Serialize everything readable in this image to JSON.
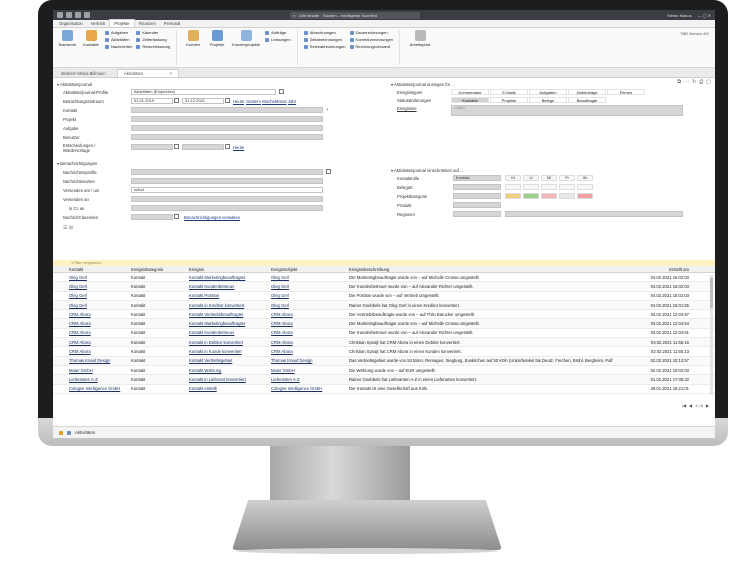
{
  "app": {
    "search_placeholder": "Alle Inhalte",
    "search_hint": "Suchen – Intelligente Suchfeld",
    "user": "Stefan Manos",
    "company": "TBB Service AG"
  },
  "ribbon_tabs": [
    "Organisation",
    "Vertrieb",
    "Projekte",
    "Finanzen",
    "Personal"
  ],
  "ribbon": {
    "teamwork": "Teamwork",
    "kontakte": "Kontakte",
    "aufgaben": "Aufgaben",
    "aktivitaeten": "Aktivitäten",
    "nachrichten": "Nachrichten",
    "kalender": "Kalender",
    "zeiterfassung": "Zeiterfassung",
    "reiseerfassung": "Reiseerfassung",
    "kunden": "Kunden",
    "projekte": "Projekte",
    "kundenprojekte": "Kundenprojekte",
    "auftraege": "Aufträge",
    "leistungen": "Leistungen",
    "abrechnungen": "Abrechnungen",
    "zeitabrechnungen": "Zeitabrechnungen",
    "reiseabrechnungen": "Reiseabrechnungen",
    "dauerrechnungen": "Dauerrechnungen",
    "korrekturrechnungen": "Korrekturrechnungen",
    "rechnungsversand": "Rechnungsversand",
    "arbeitsplatz": "Arbeitsplatz"
  },
  "doc_tabs": [
    "Mehrern-Maria Billmann",
    "Aktivitäten"
  ],
  "journal": {
    "heading": "Aktivitätenjournal",
    "profile_label": "Aktivitätenjournal-Profile",
    "profile_value": "Aktivitäten (Empfohlen)",
    "period_label": "Betrachtungszeitraum",
    "date_from": "01.01.2019",
    "date_to": "31.12.2021",
    "quick_links": [
      "Heute",
      "Gestern",
      "Woche",
      "Monat",
      "Jahr"
    ],
    "kontakt": "Kontakt",
    "projekt": "Projekt",
    "aufgabe": "Aufgabe",
    "benutzer": "Benutzer",
    "entscheidungen": "Entscheidungen / Wiedervorlage",
    "heute": "Heute"
  },
  "show_for": {
    "heading": "Aktivitätenjournal anzeigen für ...",
    "ereignistypen": "Ereignistypen",
    "statusaenderungen": "Statusänderungen",
    "ereignisse": "Ereignisse",
    "row1": [
      "Kommentare",
      "E-Mails",
      "Aufgaben",
      "Zeiteinträge",
      "Firmen"
    ],
    "row2": [
      "Kontakte",
      "Projekte",
      "Belege",
      "Beauftragte"
    ],
    "placeholder": "<Alle>"
  },
  "notify": {
    "heading": "Benachrichtigungen",
    "profile": "Nachrichtenprofile",
    "arten": "Nachrichtenarten",
    "versenden_am": "Versenden am / um",
    "versenden_value": "sofort",
    "versenden_an": "Versenden an",
    "cc": "in Cc an",
    "beenden": "Nachricht beenden",
    "verwalten": "Benachrichtigungen verwalten"
  },
  "restrict": {
    "heading": "Aktivitätenjournal einschränken auf ...",
    "kontaktrolle": "Kontaktrolle",
    "kontaktrolle_value": "Kontakt",
    "belegart": "Belegart",
    "projektkategorie": "Projektkategorie",
    "produkt": "Produkt",
    "regionen": "Regionen",
    "role_chips": [
      "Kt",
      "Lf",
      "Mi",
      "Pr",
      "Gh"
    ]
  },
  "filter_bar": "<Filter eingeben>",
  "columns": [
    "Kontakt",
    "Ereigniskategorie",
    "Ereignis",
    "Ereignisobjekt",
    "Ereignisbeschreibung",
    "Erstellt am"
  ],
  "rows": [
    [
      "Oleg Gerl",
      "Kontakt",
      "Kontakt Marketingbeauftragter",
      "Oleg Gerl",
      "Der Marketingbeauftragte wurde von – auf Michelle Crossa umgestellt.",
      "04.02.2021 15:02:03"
    ],
    [
      "Oleg Gerl",
      "Kontakt",
      "Kontakt Kundenbetreuer",
      "Oleg Gerl",
      "Der Kundenbetreuer wurde von – auf Alexander Richter umgestellt.",
      "04.02.2021 15:02:03"
    ],
    [
      "Oleg Gerl",
      "Kontakt",
      "Kontakt Position",
      "Oleg Gerl",
      "Die Position wurde von – auf Vertrieb umgestellt.",
      "04.02.2021 15:02:03"
    ],
    [
      "Oleg Gerl",
      "Kontakt",
      "Kontakt in Kreditor konvertiert",
      "Oleg Gerl",
      "Rainer Goebbels hat Oleg Gerl in einen Kreditor konvertiert.",
      "04.02.2021 15:01:55"
    ],
    [
      "CRM Abora",
      "Kontakt",
      "Kontakt Vertriebsbeauftragter",
      "CRM Abora",
      "Der Vertriebsbeauftragte wurde von – auf Thilo Barucker umgestellt.",
      "03.02.2021 12:04:57"
    ],
    [
      "CRM Abora",
      "Kontakt",
      "Kontakt Marketingbeauftragter",
      "CRM Abora",
      "Der Marketingbeauftragte wurde von – auf Michelle Crossa umgestellt.",
      "03.02.2021 12:04:54"
    ],
    [
      "CRM Abora",
      "Kontakt",
      "Kontakt Kundenbetreuer",
      "CRM Abora",
      "Der Kundenbetreuer wurde von – auf Alexander Richter umgestellt.",
      "03.02.2021 12:04:51"
    ],
    [
      "CRM Abora",
      "Kontakt",
      "Kontakt in Debitor konvertiert",
      "CRM Abora",
      "Christian Spraijt hat CRM Abora in einen Debitor konvertiert.",
      "03.02.2021 11:56:16"
    ],
    [
      "CRM Abora",
      "Kontakt",
      "Kontakt in Kunde konvertiert",
      "CRM Abora",
      "Christian Spraijt hat CRM Abora in einen Kunden konvertiert.",
      "03.02.2021 11:55:13"
    ],
    [
      "Thomas Knauf Design",
      "Kontakt",
      "Kontakt Vertriebsgebiet",
      "Thomas Knauf Design",
      "Das Vertriebsgebiet wurde von 53 Bonn, Remagen, Siegburg, Euskirchen auf 50 Köln (Unkorfwinkel bis Deutz, Frechen, Brühl, Bergheim, Pulheim, Kerpen) umgestellt.",
      "02.02.2021 10:12:57"
    ],
    [
      "Maier GmbH",
      "Kontakt",
      "Kontakt Währung",
      "Maier GmbH",
      "Die Währung wurde von – auf EUR umgestellt.",
      "02.02.2021 10:02:03"
    ],
    [
      "Lieferanten A-Z",
      "Kontakt",
      "Kontakt in Lieferant konvertiert",
      "Lieferanten A-Z",
      "Rainer Goebbels hat Lieferanten A-Z in einen Lieferanten konvertiert.",
      "01.02.2021 17:05:32"
    ],
    [
      "Cologne Intelligence GmbH",
      "Kontakt",
      "Kontakt erstellt",
      "Cologne Intelligence GmbH",
      "Der Kontakt ist eine Gesellschaft aus Köln.",
      "29.01.2021 15:21:01"
    ]
  ],
  "pager": "1 / 8",
  "status": "Aktivitäten"
}
